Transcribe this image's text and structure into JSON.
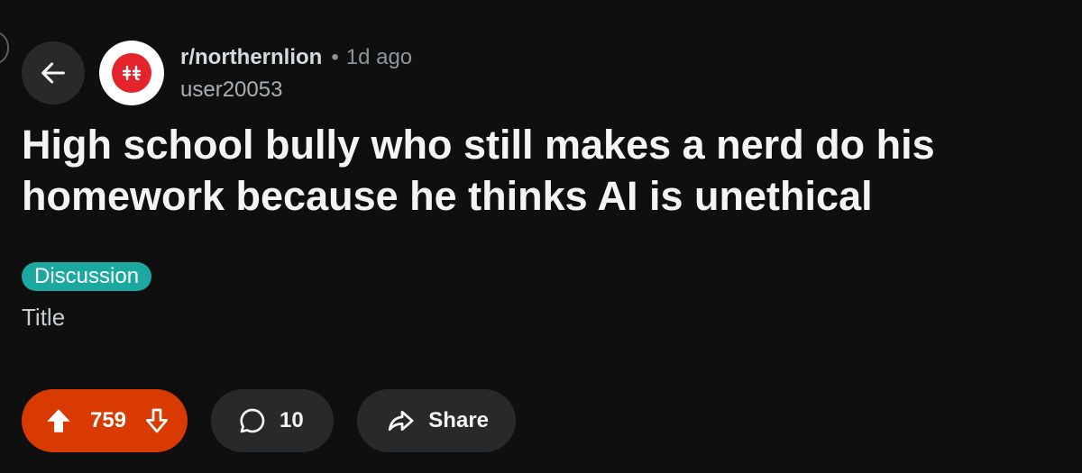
{
  "post": {
    "subreddit": "r/northernlion",
    "separator": "•",
    "time_ago": "1d ago",
    "author": "user20053",
    "title": "High school bully who still makes a nerd do his homework because he thinks AI is unethical",
    "flair": "Discussion",
    "body": "Title"
  },
  "actions": {
    "vote_count": "759",
    "comment_count": "10",
    "share_label": "Share"
  },
  "icons": {
    "back": "arrow-left-icon",
    "subreddit_avatar": "northernlion-logo",
    "upvote": "upvote-arrow-icon",
    "downvote": "downvote-arrow-icon",
    "comment": "speech-bubble-icon",
    "share": "share-arrow-icon"
  },
  "colors": {
    "background": "#0f0f10",
    "vote_active": "#d93a00",
    "flair": "#1ba8a0",
    "pill_bg": "#27292b",
    "avatar_red": "#e4232b"
  }
}
